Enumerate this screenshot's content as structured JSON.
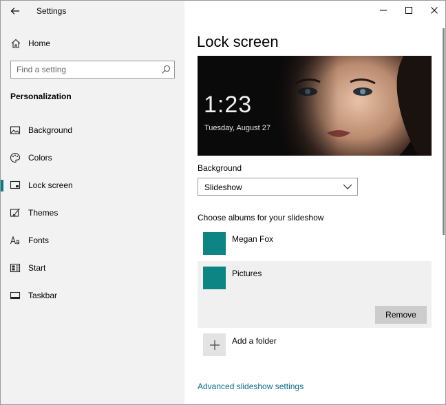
{
  "window": {
    "title": "Settings"
  },
  "sidebar": {
    "home_label": "Home",
    "search_placeholder": "Find a setting",
    "section_title": "Personalization",
    "items": [
      {
        "label": "Background",
        "icon": "picture-icon"
      },
      {
        "label": "Colors",
        "icon": "palette-icon"
      },
      {
        "label": "Lock screen",
        "icon": "lock-screen-icon",
        "selected": true
      },
      {
        "label": "Themes",
        "icon": "brush-icon"
      },
      {
        "label": "Fonts",
        "icon": "font-icon"
      },
      {
        "label": "Start",
        "icon": "start-icon"
      },
      {
        "label": "Taskbar",
        "icon": "taskbar-icon"
      }
    ]
  },
  "main": {
    "title": "Lock screen",
    "preview": {
      "time": "1:23",
      "date": "Tuesday, August 27"
    },
    "background_label": "Background",
    "background_value": "Slideshow",
    "albums_label": "Choose albums for your slideshow",
    "albums": [
      {
        "name": "Megan Fox"
      },
      {
        "name": "Pictures"
      }
    ],
    "remove_label": "Remove",
    "add_folder_label": "Add a folder",
    "advanced_link": "Advanced slideshow settings"
  },
  "colors": {
    "accent": "#0a7a87",
    "album_thumb": "#0e8585",
    "sidebar_bg": "#f2f2f2",
    "link": "#0a6a8a",
    "annotation_arrow": "#e8202a"
  }
}
